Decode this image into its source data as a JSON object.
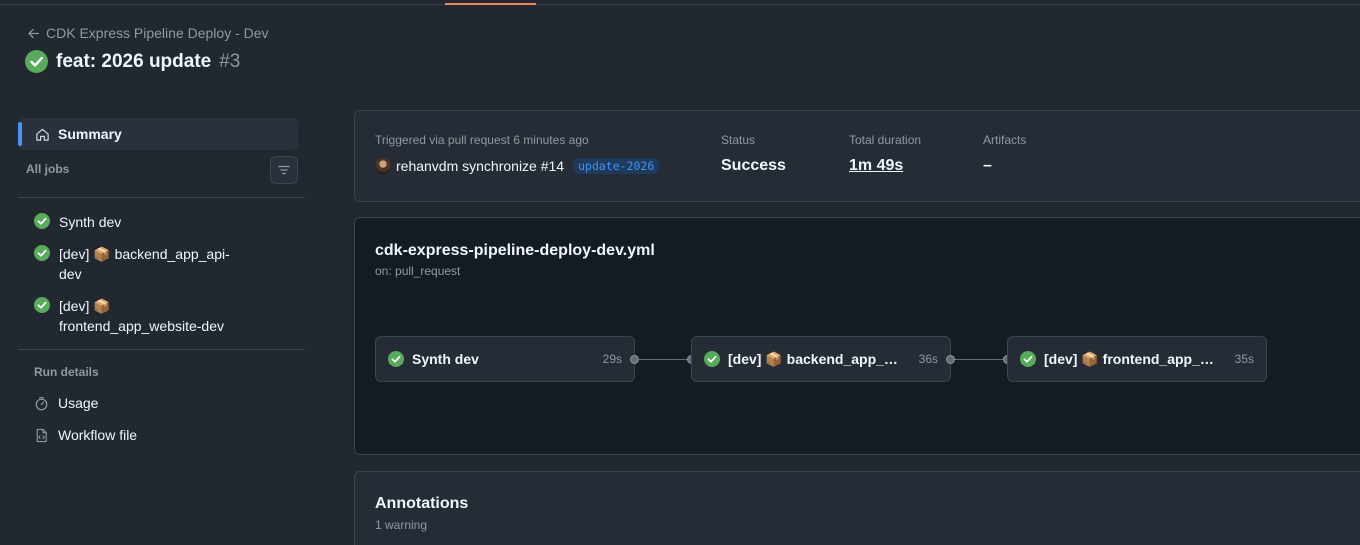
{
  "header": {
    "workflow_name": "CDK Express Pipeline Deploy - Dev",
    "run_title": "feat: 2026 update",
    "run_number": "#3"
  },
  "sidebar": {
    "summary_label": "Summary",
    "all_jobs_label": "All jobs",
    "jobs": [
      {
        "line1": "Synth dev",
        "line2": ""
      },
      {
        "line1": "[dev] 📦 backend_app_api-",
        "line2": "dev"
      },
      {
        "line1": "[dev] 📦",
        "line2": "frontend_app_website-dev"
      }
    ],
    "run_details_label": "Run details",
    "usage_label": "Usage",
    "workflow_file_label": "Workflow file"
  },
  "summary": {
    "trigger_label": "Triggered via pull request 6 minutes ago",
    "trigger_text": "rehanvdm synchronize #14",
    "branch": "update-2026",
    "status_label": "Status",
    "status_value": "Success",
    "duration_label": "Total duration",
    "duration_value": "1m 49s",
    "artifacts_label": "Artifacts",
    "artifacts_value": "–"
  },
  "graph": {
    "file": "cdk-express-pipeline-deploy-dev.yml",
    "on": "on: pull_request",
    "nodes": [
      {
        "name": "Synth dev",
        "duration": "29s"
      },
      {
        "name": "[dev] 📦 backend_app_api-dev",
        "duration": "36s"
      },
      {
        "name": "[dev] 📦 frontend_app_website-dev",
        "duration": "35s"
      }
    ]
  },
  "annotations": {
    "title": "Annotations",
    "count": "1 warning"
  },
  "colors": {
    "background": "#212830",
    "success": "#57ab5a",
    "accent": "#4493f8",
    "tab_underline": "#f78166"
  },
  "icons": [
    "arrow-left-icon",
    "check-circle-icon",
    "home-icon",
    "filter-icon",
    "stopwatch-icon",
    "file-code-icon"
  ]
}
